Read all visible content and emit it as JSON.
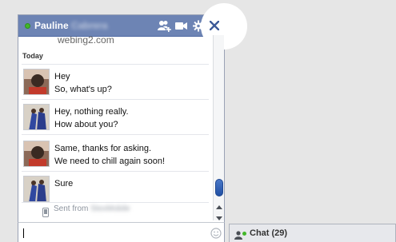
{
  "titlebar": {
    "first_name": "Pauline",
    "last_name": "Cabrera",
    "icons": [
      "add-friends-icon",
      "video-call-icon",
      "gear-icon",
      "close-icon"
    ]
  },
  "subtitle": "webing2.com",
  "conversation": {
    "day_label": "Today",
    "messages": [
      {
        "lines": [
          "Hey",
          "So, what's up?"
        ]
      },
      {
        "lines": [
          "Hey, nothing really.",
          "How about you?"
        ]
      },
      {
        "lines": [
          "Same, thanks for asking.",
          "We need to chill again soon!"
        ]
      },
      {
        "lines": [
          "Sure"
        ]
      }
    ],
    "sent_from_prefix": "Sent from",
    "sent_from_device": "StexMobile"
  },
  "input": {
    "placeholder": ""
  },
  "chat_tab": {
    "label": "Chat",
    "count": "(29)"
  },
  "colors": {
    "titlebar": "#6d84b4",
    "presence_green": "#42b72a",
    "scroll_thumb": "#2f62b7"
  }
}
